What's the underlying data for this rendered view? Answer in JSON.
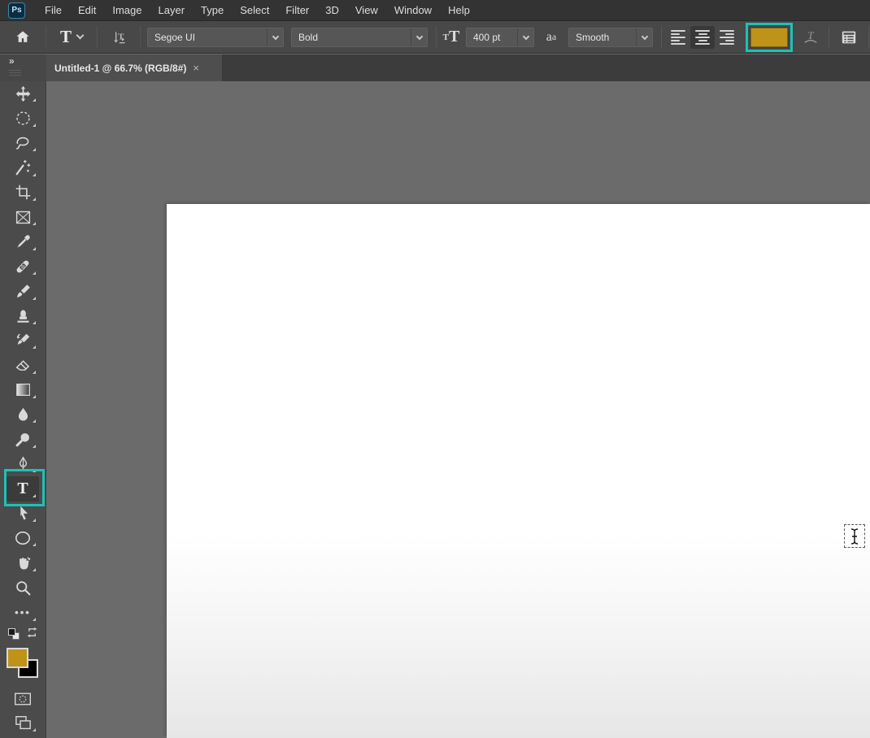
{
  "app": {
    "logo_text": "Ps"
  },
  "menu_bar": {
    "items": [
      "File",
      "Edit",
      "Image",
      "Layer",
      "Type",
      "Select",
      "Filter",
      "3D",
      "View",
      "Window",
      "Help"
    ]
  },
  "options_bar": {
    "tool_glyph": "T",
    "font_family": {
      "value": "Segoe UI"
    },
    "font_style": {
      "value": "Bold"
    },
    "font_size_icon": {
      "small": "T",
      "large": "T"
    },
    "font_size": {
      "value": "400 pt"
    },
    "anti_alias_icon": {
      "a_large": "a",
      "a_small": "a"
    },
    "anti_alias": {
      "value": "Smooth"
    },
    "alignment_active": "center",
    "text_color_swatch": "#bf9218"
  },
  "tab_bar": {
    "collapse_glyph": "»",
    "document_tab": {
      "title": "Untitled-1 @ 66.7% (RGB/8#)",
      "close_glyph": "×"
    }
  },
  "toolbar": {
    "tools": [
      {
        "name": "move-tool",
        "selected": false
      },
      {
        "name": "elliptical-marquee-tool",
        "selected": false
      },
      {
        "name": "lasso-tool",
        "selected": false
      },
      {
        "name": "magic-wand-tool",
        "selected": false
      },
      {
        "name": "crop-tool",
        "selected": false
      },
      {
        "name": "frame-tool",
        "selected": false
      },
      {
        "name": "eyedropper-tool",
        "selected": false
      },
      {
        "name": "healing-brush-tool",
        "selected": false
      },
      {
        "name": "brush-tool",
        "selected": false
      },
      {
        "name": "clone-stamp-tool",
        "selected": false
      },
      {
        "name": "history-brush-tool",
        "selected": false
      },
      {
        "name": "eraser-tool",
        "selected": false
      },
      {
        "name": "gradient-tool",
        "selected": false
      },
      {
        "name": "blur-tool",
        "selected": false
      },
      {
        "name": "dodge-tool",
        "selected": false
      },
      {
        "name": "pen-tool",
        "selected": false
      },
      {
        "name": "type-tool",
        "selected": true
      },
      {
        "name": "path-selection-tool",
        "selected": false
      },
      {
        "name": "ellipse-tool",
        "selected": false
      },
      {
        "name": "hand-tool",
        "selected": false
      },
      {
        "name": "zoom-tool",
        "selected": false
      },
      {
        "name": "edit-toolbar",
        "selected": false
      }
    ],
    "type_tool_glyph": "T",
    "more_glyph": "•••",
    "foreground_color": "#bf9218",
    "background_color": "#000000"
  },
  "annotations": {
    "highlight_color": "#1cc2b7"
  }
}
